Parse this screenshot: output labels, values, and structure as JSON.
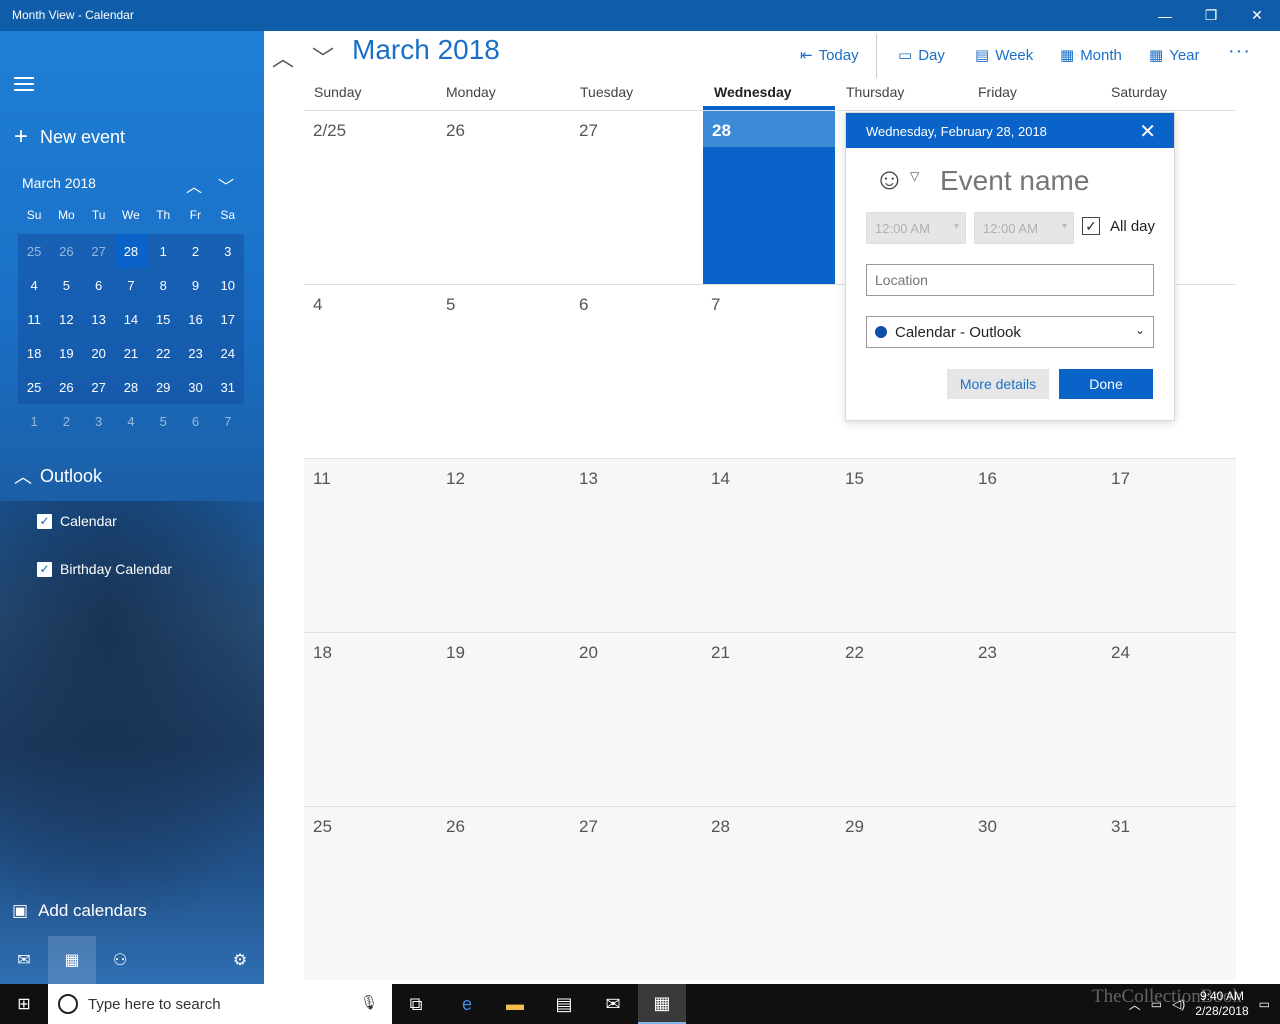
{
  "window": {
    "title": "Month View - Calendar",
    "minimize": "—",
    "restore": "❐",
    "close": "✕"
  },
  "sidebar": {
    "new_event": "New event",
    "mini": {
      "title": "March 2018",
      "weekdays": [
        "Su",
        "Mo",
        "Tu",
        "We",
        "Th",
        "Fr",
        "Sa"
      ],
      "weeks": [
        [
          "25",
          "26",
          "27",
          "28",
          "1",
          "2",
          "3"
        ],
        [
          "4",
          "5",
          "6",
          "7",
          "8",
          "9",
          "10"
        ],
        [
          "11",
          "12",
          "13",
          "14",
          "15",
          "16",
          "17"
        ],
        [
          "18",
          "19",
          "20",
          "21",
          "22",
          "23",
          "24"
        ],
        [
          "25",
          "26",
          "27",
          "28",
          "29",
          "30",
          "31"
        ],
        [
          "1",
          "2",
          "3",
          "4",
          "5",
          "6",
          "7"
        ]
      ]
    },
    "group": "Outlook",
    "calendars": [
      {
        "label": "Calendar",
        "checked": true
      },
      {
        "label": "Birthday Calendar",
        "checked": true
      }
    ],
    "add_calendars": "Add calendars"
  },
  "toolbar": {
    "month": "March 2018",
    "today": "Today",
    "day": "Day",
    "week": "Week",
    "month_btn": "Month",
    "year": "Year",
    "more": "···"
  },
  "days_of_week": [
    "Sunday",
    "Monday",
    "Tuesday",
    "Wednesday",
    "Thursday",
    "Friday",
    "Saturday"
  ],
  "month_grid": [
    [
      "2/25",
      "26",
      "27",
      "28",
      "",
      "",
      ""
    ],
    [
      "4",
      "5",
      "6",
      "7",
      "",
      "",
      ""
    ],
    [
      "11",
      "12",
      "13",
      "14",
      "15",
      "16",
      "17"
    ],
    [
      "18",
      "19",
      "20",
      "21",
      "22",
      "23",
      "24"
    ],
    [
      "25",
      "26",
      "27",
      "28",
      "29",
      "30",
      "31"
    ]
  ],
  "popup": {
    "date": "Wednesday, February 28, 2018",
    "event_placeholder": "Event name",
    "start_time": "12:00 AM",
    "end_time": "12:00 AM",
    "all_day": "All day",
    "location_placeholder": "Location",
    "calendar": "Calendar - Outlook",
    "more_details": "More details",
    "done": "Done"
  },
  "taskbar": {
    "search_placeholder": "Type here to search",
    "time": "9:40 AM",
    "date": "2/28/2018",
    "watermark": "TheCollectionBook"
  },
  "colors": {
    "accent": "#0a63c9",
    "titlebar": "#0f5ca8",
    "link": "#1a70c8"
  }
}
